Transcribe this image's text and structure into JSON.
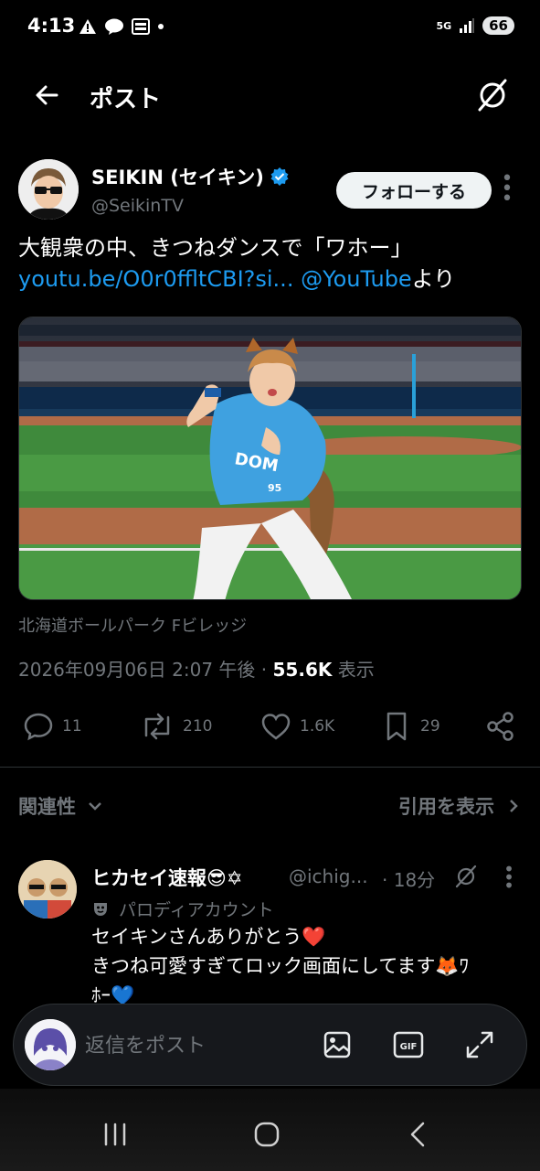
{
  "status_bar": {
    "time": "4:13",
    "network": "5G",
    "battery": "66"
  },
  "header": {
    "title": "ポスト"
  },
  "post": {
    "author_name": "SEIKIN (セイキン)",
    "author_handle": "@SeikinTV",
    "follow_label": "フォローする",
    "text_line1": "大観衆の中、きつねダンスで「ワホー」",
    "link_text": "youtu.be/O0r0ffltCBI?si...",
    "mention": "@YouTube",
    "text_suffix": "より",
    "location": "北海道ボールパーク Fビレッジ",
    "datetime": "2026年09月06日 2:07 午後",
    "views_count": "55.6K",
    "views_label": "表示",
    "jersey_number": "95",
    "stats": {
      "replies": "11",
      "reposts": "210",
      "likes": "1.6K",
      "bookmarks": "29"
    }
  },
  "sort": {
    "left_label": "関連性",
    "right_label": "引用を表示"
  },
  "reply": {
    "name": "ヒカセイ速報😎✡",
    "handle": "@ichig...",
    "time": "· 18分",
    "parody_label": "パロディアカウント",
    "text_line1": "セイキンさんありがとう❤️",
    "text_line2": "きつね可愛すぎてロック画面にしてます🦊ﾜ",
    "text_line3": "ﾎｰ💙"
  },
  "compose": {
    "placeholder": "返信をポスト"
  },
  "colors": {
    "background": "#000000",
    "link": "#1d9bf0",
    "muted": "#71767b",
    "verified": "#1d9bf0"
  }
}
